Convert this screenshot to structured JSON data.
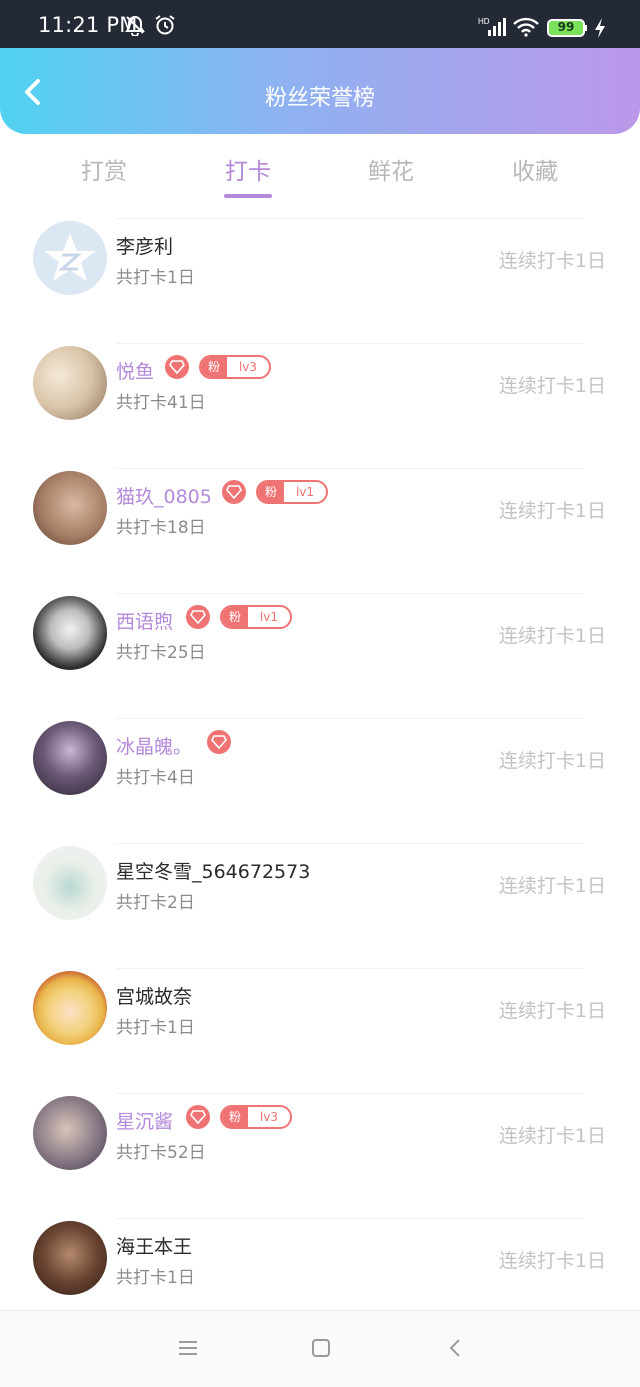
{
  "status_bar": {
    "time": "11:21 PM",
    "icons": [
      "mute-icon",
      "alarm-icon",
      "signal-icon",
      "wifi-icon",
      "battery-icon",
      "charging-icon"
    ],
    "battery": "99"
  },
  "header": {
    "title": "粉丝荣誉榜",
    "back_icon": "back-arrow-icon",
    "gradient": [
      "#50d2f0",
      "#bb97ea"
    ]
  },
  "tabs": [
    {
      "label": "打赏",
      "active": false
    },
    {
      "label": "打卡",
      "active": true
    },
    {
      "label": "鲜花",
      "active": false
    },
    {
      "label": "收藏",
      "active": false
    }
  ],
  "colors": {
    "accent": "#b489d9",
    "badge": "#f07373"
  },
  "fans": [
    {
      "name": "李彦利",
      "total": "共打卡1日",
      "streak": "连续打卡1日",
      "vip": false,
      "gem": false,
      "fan_label": "",
      "level": ""
    },
    {
      "name": "悦鱼",
      "total": "共打卡41日",
      "streak": "连续打卡1日",
      "vip": true,
      "gem": true,
      "fan_label": "粉",
      "level": "lv3"
    },
    {
      "name": "猫玖_0805",
      "total": "共打卡18日",
      "streak": "连续打卡1日",
      "vip": true,
      "gem": true,
      "fan_label": "粉",
      "level": "lv1"
    },
    {
      "name": "西语煦",
      "total": "共打卡25日",
      "streak": "连续打卡1日",
      "vip": true,
      "gem": true,
      "fan_label": "粉",
      "level": "lv1"
    },
    {
      "name": "冰晶魄。",
      "total": "共打卡4日",
      "streak": "连续打卡1日",
      "vip": true,
      "gem": true,
      "fan_label": "",
      "level": ""
    },
    {
      "name": "星空冬雪_564672573",
      "total": "共打卡2日",
      "streak": "连续打卡1日",
      "vip": false,
      "gem": false,
      "fan_label": "",
      "level": ""
    },
    {
      "name": "宫城故奈",
      "total": "共打卡1日",
      "streak": "连续打卡1日",
      "vip": false,
      "gem": false,
      "fan_label": "",
      "level": ""
    },
    {
      "name": "星沉酱",
      "total": "共打卡52日",
      "streak": "连续打卡1日",
      "vip": true,
      "gem": true,
      "fan_label": "粉",
      "level": "lv3"
    },
    {
      "name": "海王本王",
      "total": "共打卡1日",
      "streak": "连续打卡1日",
      "vip": false,
      "gem": false,
      "fan_label": "",
      "level": ""
    }
  ],
  "nav_bar": {
    "icons": [
      "menu-icon",
      "home-icon",
      "back-icon"
    ]
  }
}
